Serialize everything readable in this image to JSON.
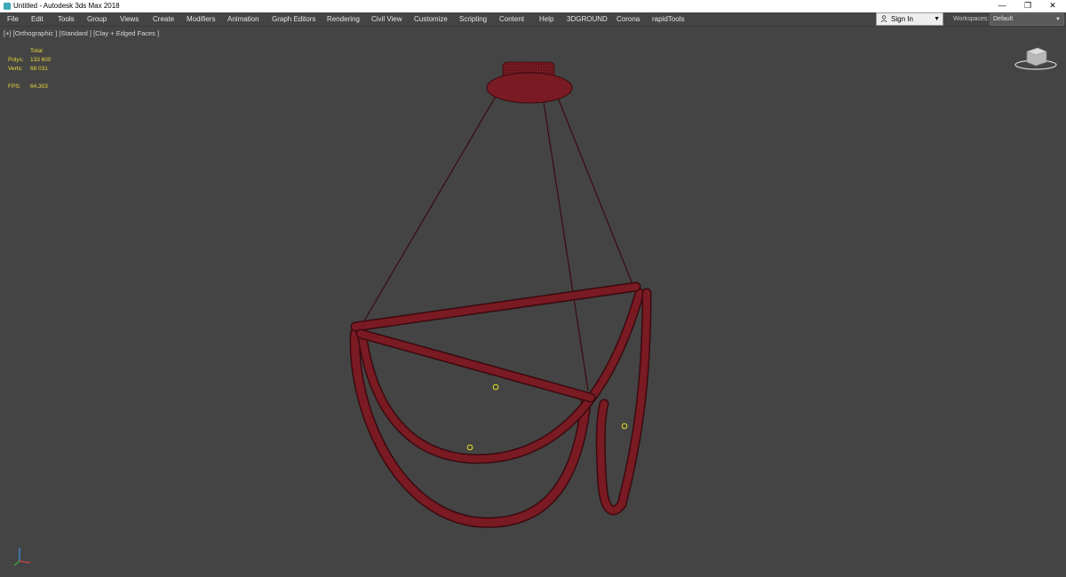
{
  "window": {
    "title": "Untitled - Autodesk 3ds Max 2018",
    "minimize_glyph": "—",
    "restore_glyph": "❐",
    "close_glyph": "✕"
  },
  "menu": {
    "items": [
      {
        "label": "File"
      },
      {
        "label": "Edit"
      },
      {
        "label": "Tools"
      },
      {
        "label": "Group"
      },
      {
        "label": "Views"
      },
      {
        "label": "Create"
      },
      {
        "label": "Modifiers"
      },
      {
        "label": "Animation"
      },
      {
        "label": "Graph Editors"
      },
      {
        "label": "Rendering"
      },
      {
        "label": "Civil View"
      },
      {
        "label": "Customize"
      },
      {
        "label": "Scripting"
      },
      {
        "label": "Content"
      },
      {
        "label": "Help"
      },
      {
        "label": "3DGROUND"
      },
      {
        "label": "Corona"
      },
      {
        "label": "rapidTools"
      }
    ],
    "signin_label": "Sign In",
    "workspaces_label": "Workspaces:",
    "workspace_value": "Default"
  },
  "viewport": {
    "label": "[+] [Orthographic ] [Standard ] [Clay + Edged Faces ]",
    "stats": {
      "header": "Total",
      "polys_label": "Polys:",
      "polys_value": "133 600",
      "verts_label": "Verts:",
      "verts_value": "68 031",
      "fps_label": "FPS:",
      "fps_value": "64,303"
    }
  },
  "colors": {
    "background": "#444444",
    "mesh": "#7a1a22",
    "mesh_wire": "#3a0a10",
    "stats_text": "#e8d83a",
    "pivot": "#e8e020"
  },
  "icons": {
    "app": "3ds-max-icon",
    "user": "user-icon",
    "viewcube": "viewcube-icon",
    "axis": "axis-tripod-icon"
  }
}
